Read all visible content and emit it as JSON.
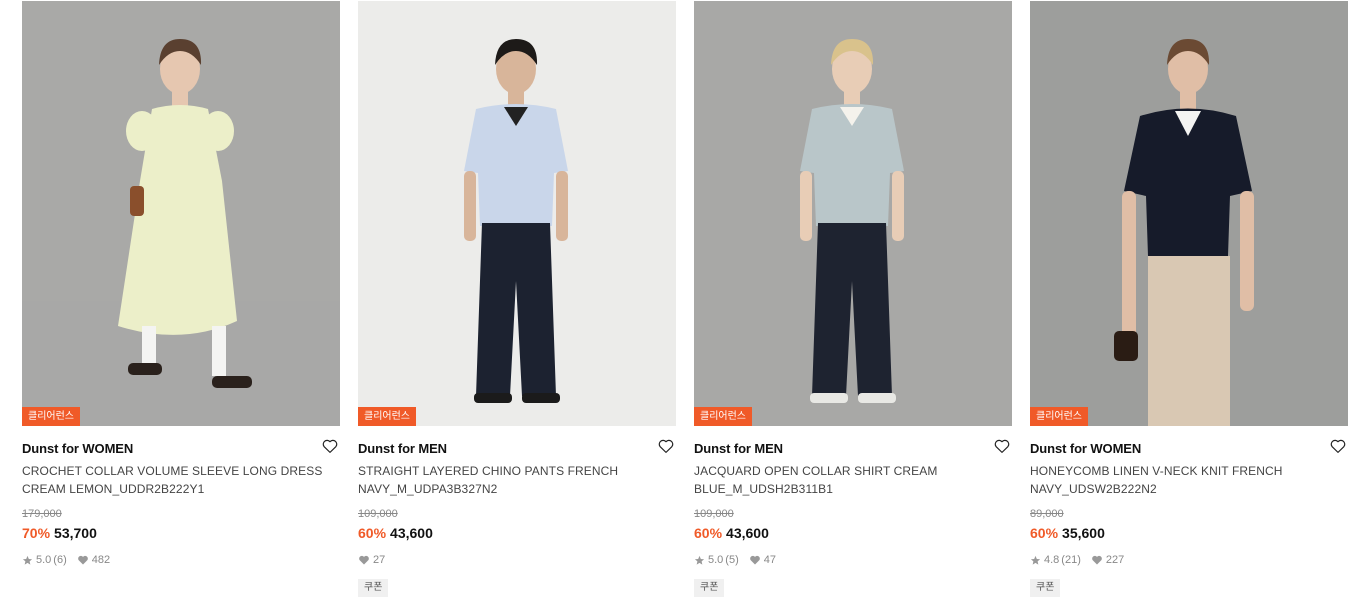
{
  "products": [
    {
      "tag": "클리어런스",
      "brand": "Dunst for WOMEN",
      "name": "CROCHET COLLAR VOLUME SLEEVE LONG DRESS CREAM LEMON_UDDR2B222Y1",
      "original_price": "179,000",
      "discount": "70%",
      "price": "53,700",
      "rating": "5.0",
      "reviews": "(6)",
      "likes": "482",
      "coupon": "",
      "photo": {
        "bg": "#a9a9a7",
        "top": "#ecefc9",
        "bottom": "#ecefc9",
        "skin": "#e6c7b0",
        "hair": "#5a4030",
        "shoe": "#2a211c",
        "style": "dress",
        "accent": "#8a4f2c"
      }
    },
    {
      "tag": "클리어런스",
      "brand": "Dunst for MEN",
      "name": "STRAIGHT LAYERED CHINO PANTS FRENCH NAVY_M_UDPA3B327N2",
      "original_price": "109,000",
      "discount": "60%",
      "price": "43,600",
      "rating": "",
      "reviews": "",
      "likes": "27",
      "coupon": "쿠폰",
      "photo": {
        "bg": "#ececea",
        "top": "#c9d6ea",
        "bottom": "#1c2230",
        "skin": "#d8b59a",
        "hair": "#1d1a18",
        "shoe": "#1b1b1b",
        "style": "pants",
        "accent": "#222222"
      }
    },
    {
      "tag": "클리어런스",
      "brand": "Dunst for MEN",
      "name": "JACQUARD OPEN COLLAR SHIRT CREAM BLUE_M_UDSH2B311B1",
      "original_price": "109,000",
      "discount": "60%",
      "price": "43,600",
      "rating": "5.0",
      "reviews": "(5)",
      "likes": "47",
      "coupon": "쿠폰",
      "photo": {
        "bg": "#a8a8a6",
        "top": "#b9c6c9",
        "bottom": "#1e2330",
        "skin": "#e8cdb6",
        "hair": "#d9c28c",
        "shoe": "#e8e8e4",
        "style": "pants",
        "accent": "#f4f2ec"
      }
    },
    {
      "tag": "클리어런스",
      "brand": "Dunst for WOMEN",
      "name": "HONEYCOMB LINEN V-NECK KNIT FRENCH NAVY_UDSW2B222N2",
      "original_price": "89,000",
      "discount": "60%",
      "price": "35,600",
      "rating": "4.8",
      "reviews": "(21)",
      "likes": "227",
      "coupon": "쿠폰",
      "photo": {
        "bg": "#9d9e9c",
        "top": "#161b2a",
        "bottom": "#d9c8b3",
        "skin": "#e0bea6",
        "hair": "#6b4a33",
        "shoe": "#2a2a2a",
        "style": "knit",
        "accent": "#2a1c14"
      }
    }
  ]
}
